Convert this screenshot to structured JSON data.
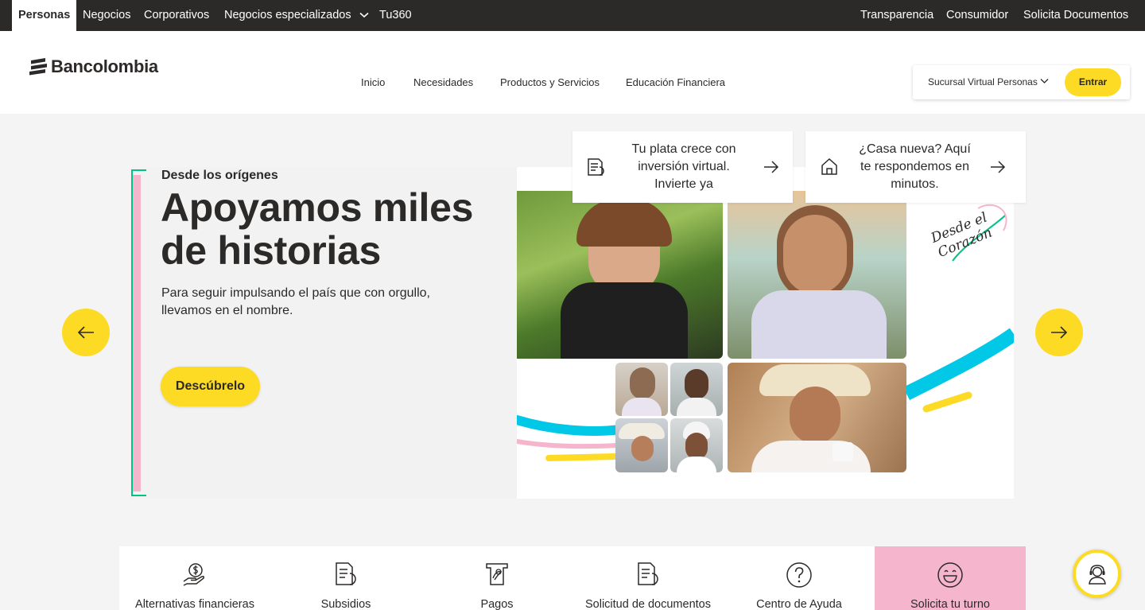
{
  "topbar": {
    "left": [
      "Personas",
      "Negocios",
      "Corporativos",
      "Negocios especializados",
      "Tu360"
    ],
    "right": [
      "Transparencia",
      "Consumidor",
      "Solicita Documentos"
    ]
  },
  "brand": {
    "name": "Bancolombia"
  },
  "nav": [
    "Inicio",
    "Necesidades",
    "Productos y Servicios",
    "Educación Financiera"
  ],
  "sucursal": {
    "label": "Sucursal Virtual Personas",
    "button": "Entrar"
  },
  "hero": {
    "eyebrow": "Desde los orígenes",
    "title": "Apoyamos miles de historias",
    "lead": "Para seguir impulsando el país que con orgullo, llevamos en el nombre.",
    "cta": "Descúbrelo",
    "art_text": "Desde el Corazón"
  },
  "promos": [
    {
      "text": "Tu plata crece con inversión virtual. Invierte ya",
      "icon": "document-icon"
    },
    {
      "text": "¿Casa nueva? Aquí te respondemos en minutos.",
      "icon": "house-icon"
    }
  ],
  "shortcuts": [
    {
      "label": "Alternativas financieras",
      "icon": "hand-coin-icon"
    },
    {
      "label": "Subsidios",
      "icon": "document-icon"
    },
    {
      "label": "Pagos",
      "icon": "bill-icon"
    },
    {
      "label": "Solicitud de documentos",
      "icon": "document-icon"
    },
    {
      "label": "Centro de Ayuda",
      "icon": "question-icon"
    },
    {
      "label": "Solicita tu turno",
      "icon": "smile-icon"
    }
  ],
  "colors": {
    "yellow": "#fdda24",
    "dark": "#2c2a29",
    "pink": "#f5b6cd",
    "green": "#00c389",
    "cyan": "#00c8e6"
  }
}
